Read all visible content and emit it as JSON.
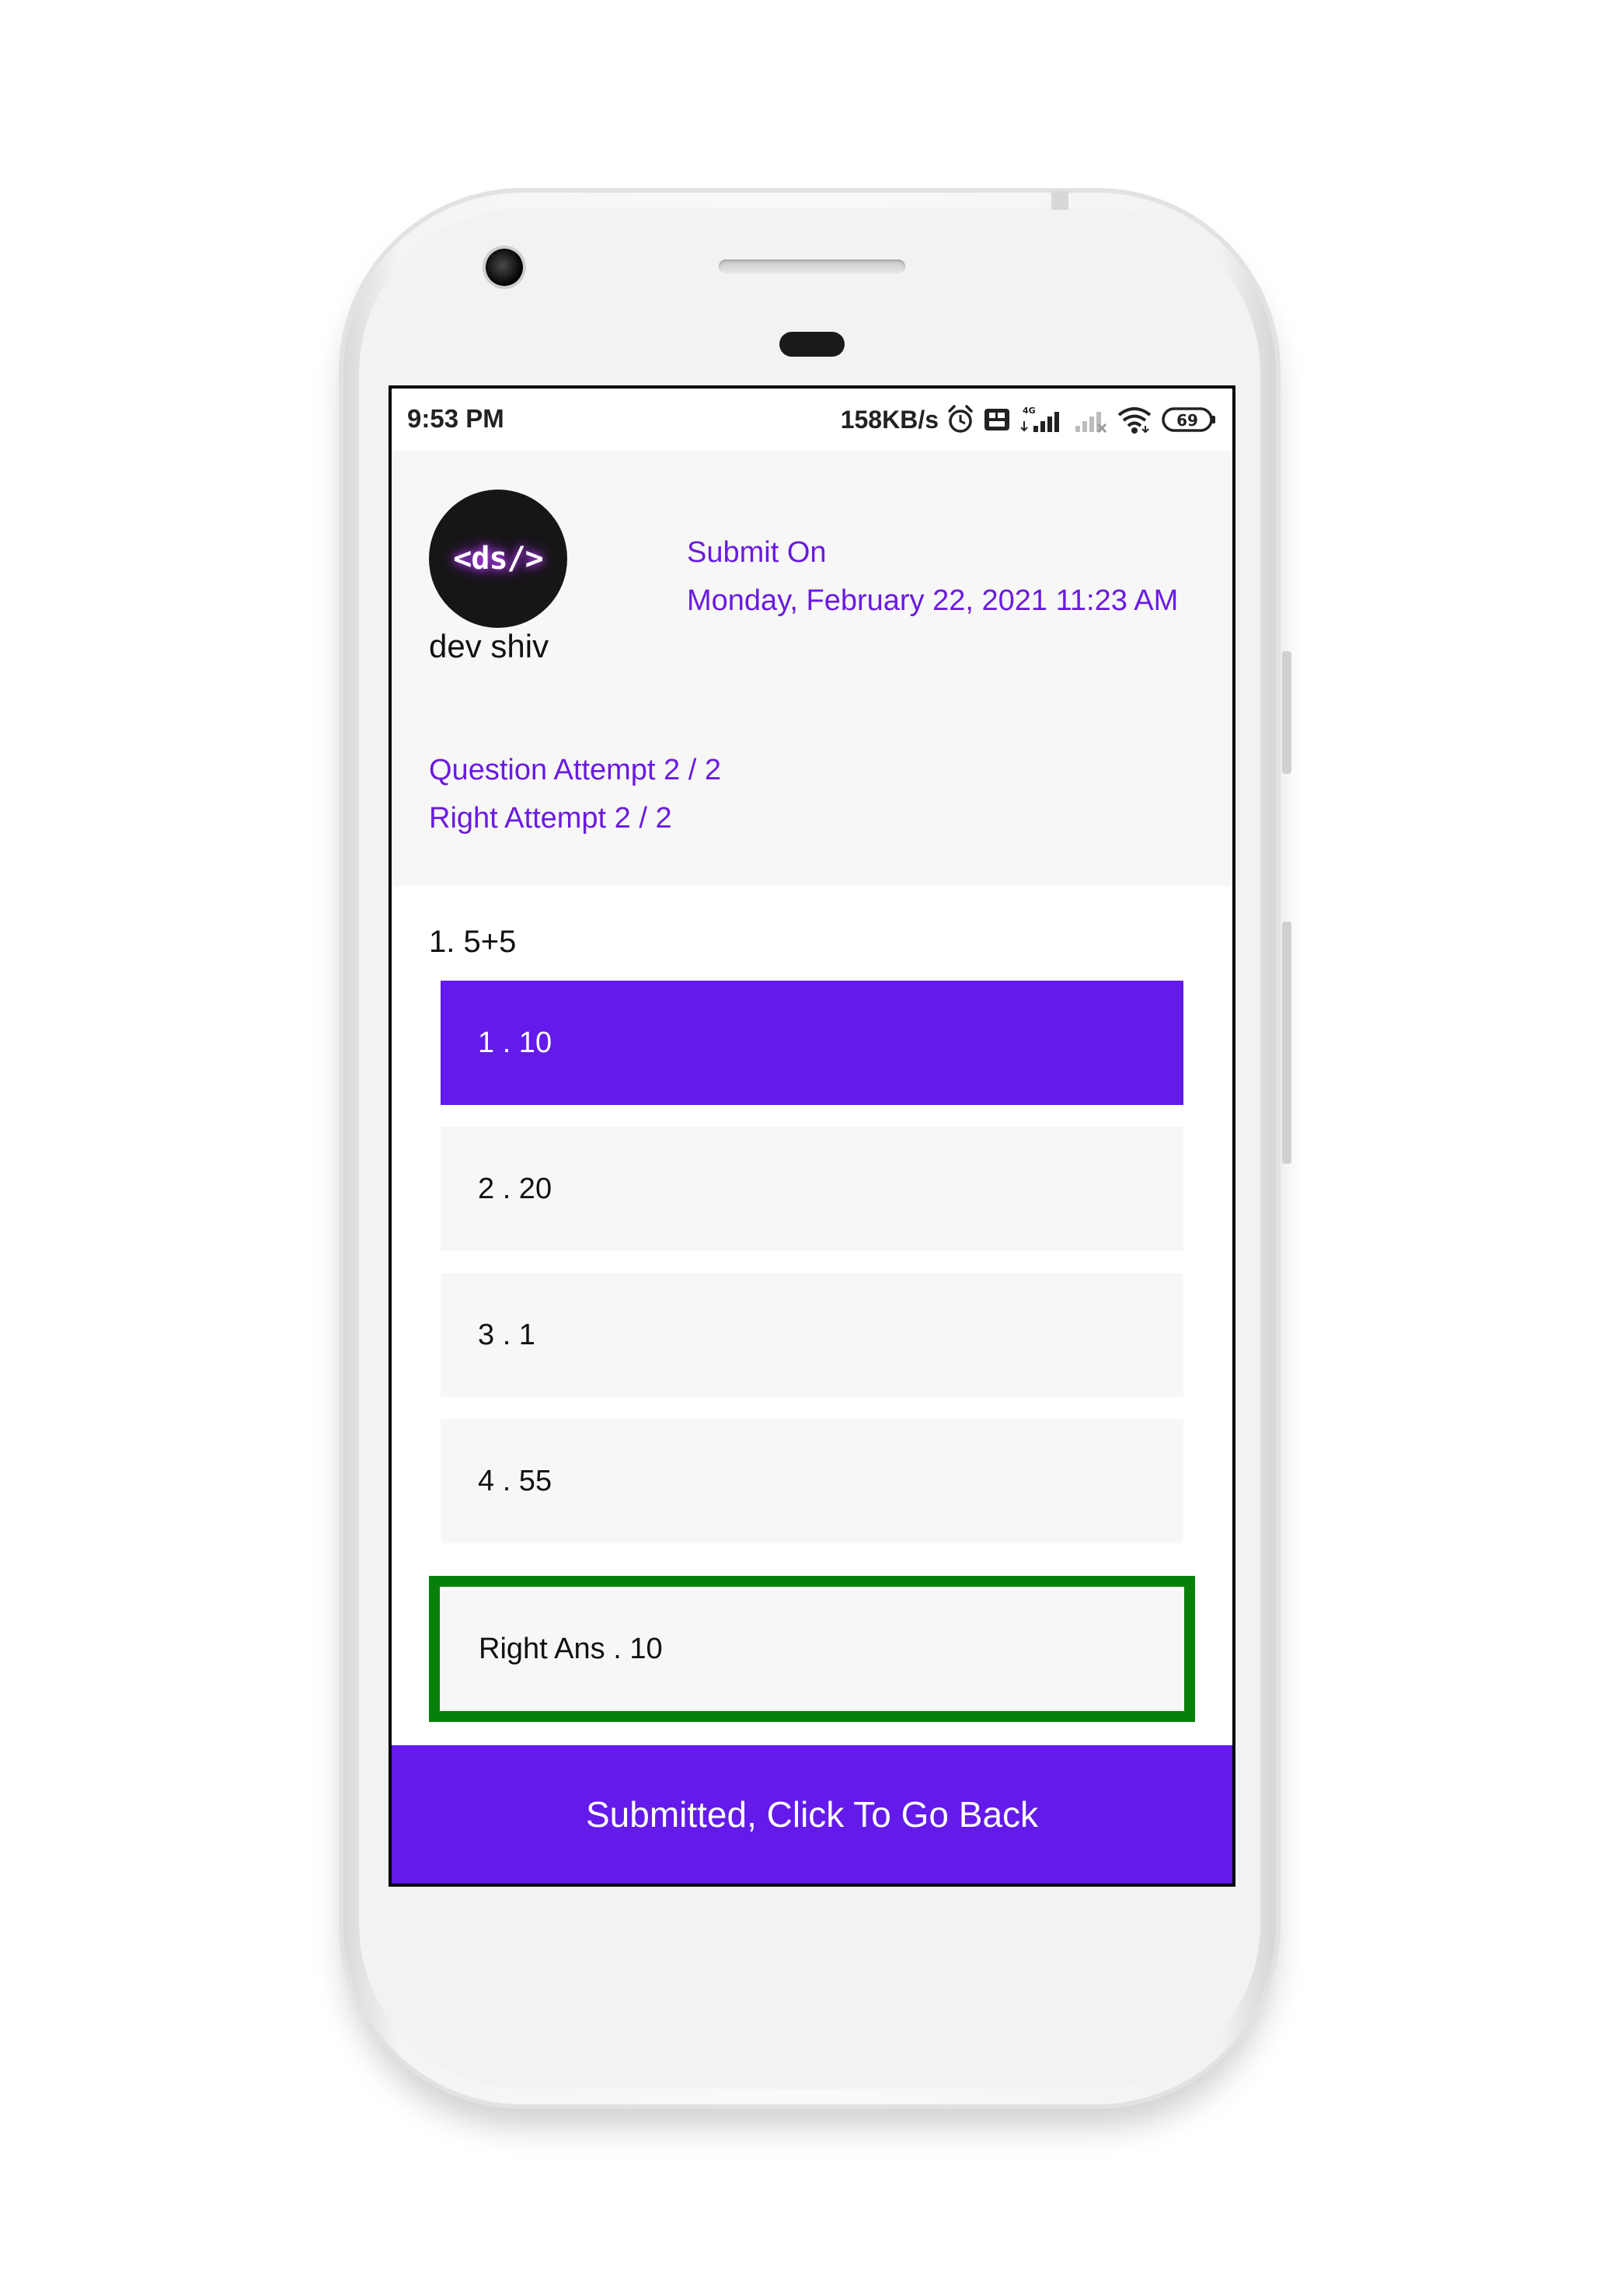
{
  "status_bar": {
    "time": "9:53 PM",
    "net_speed": "158KB/s",
    "battery": "69",
    "icons": [
      "alarm-icon",
      "volte-icon",
      "signal-4g-icon",
      "signal-weak-icon",
      "wifi-icon",
      "battery-icon"
    ]
  },
  "user": {
    "avatar_text": "<ds/>",
    "name": "dev shiv"
  },
  "submission": {
    "label": "Submit On",
    "date": "Monday, February 22, 2021 11:23 AM"
  },
  "stats": {
    "question_attempt": "Question Attempt 2 / 2",
    "right_attempt": "Right Attempt 2 / 2"
  },
  "question": {
    "text": "1. 5+5",
    "options": [
      {
        "label": "1 . 10",
        "selected": true
      },
      {
        "label": "2 . 20",
        "selected": false
      },
      {
        "label": "3 . 1",
        "selected": false
      },
      {
        "label": "4 . 55",
        "selected": false
      }
    ],
    "right_answer": "Right Ans . 10"
  },
  "footer": {
    "button_label": "Submitted, Click To Go Back"
  },
  "colors": {
    "accent": "#631aea",
    "accent_text": "#6a1bdf",
    "correct_border": "#07800a",
    "panel_bg": "#f7f7f7"
  }
}
